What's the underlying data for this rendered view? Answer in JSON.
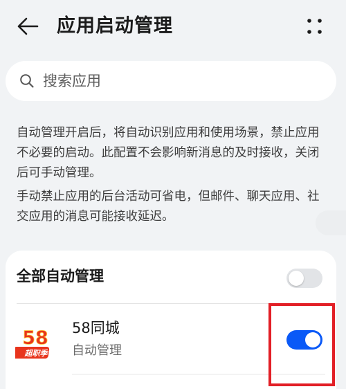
{
  "header": {
    "title": "应用启动管理",
    "back_icon": "back-arrow-icon",
    "more_icon": "more-vertical-icon"
  },
  "search": {
    "placeholder": "搜索应用",
    "value": "",
    "icon": "search-icon"
  },
  "description": {
    "paragraph1": "自动管理开启后，将自动识别应用和使用场景，禁止应用不必要的启动。此配置不会影响新消息的及时接收，关闭后可手动管理。",
    "paragraph2": "手动禁止应用的后台活动可省电，但邮件、聊天应用、社交应用的消息可能接收延迟。"
  },
  "all_auto": {
    "label": "全部自动管理",
    "enabled": false
  },
  "apps": [
    {
      "name": "58同城",
      "status": "自动管理",
      "enabled": true,
      "icon": "58-tongcheng-app-icon",
      "icon_text": "58",
      "icon_badge": "超职季"
    }
  ],
  "colors": {
    "background": "#f1f3f5",
    "accent": "#0a59f7",
    "toggle_off": "#e2e4e7",
    "highlight": "#e21f26"
  }
}
